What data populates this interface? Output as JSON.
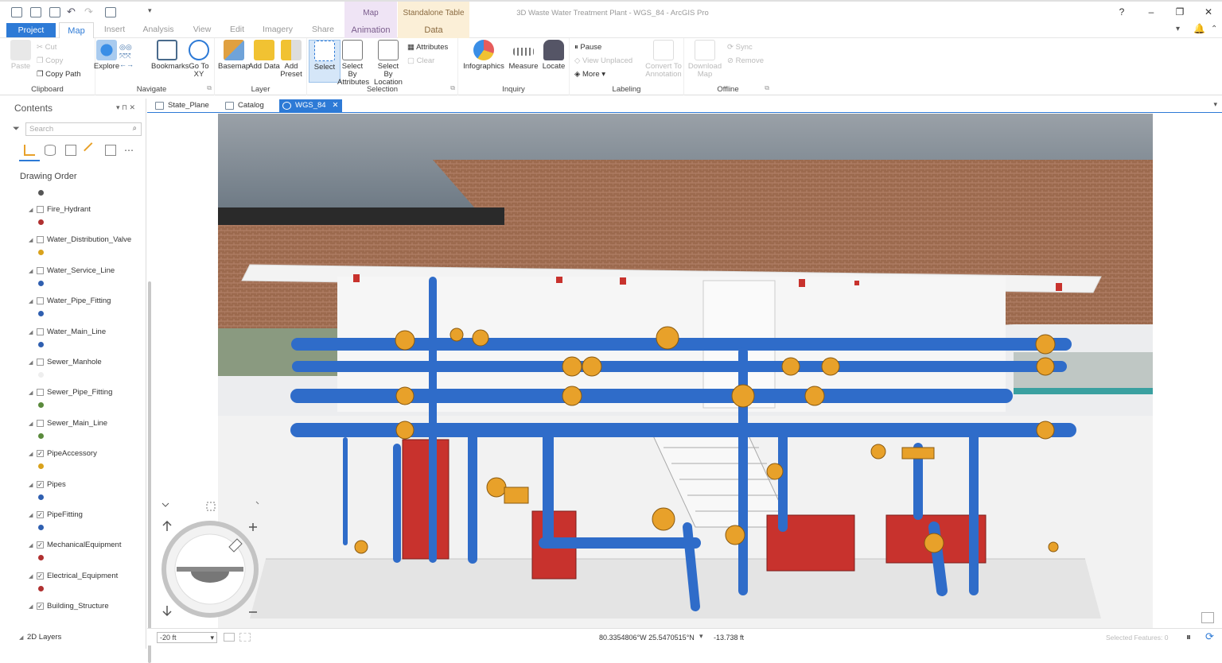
{
  "window": {
    "title": "3D Waste Water Treatment Plant - WGS_84 - ArcGIS Pro",
    "contextual_headers": {
      "map": "Map",
      "table": "Standalone Table"
    },
    "help": "?"
  },
  "ribbon_tabs": {
    "project": "Project",
    "map": "Map",
    "insert": "Insert",
    "analysis": "Analysis",
    "view": "View",
    "edit": "Edit",
    "imagery": "Imagery",
    "share": "Share",
    "animation": "Animation",
    "data": "Data"
  },
  "ribbon": {
    "clipboard": {
      "label": "Clipboard",
      "paste": "Paste",
      "cut": "Cut",
      "copy": "Copy",
      "copy_path": "Copy Path"
    },
    "navigate": {
      "label": "Navigate",
      "explore": "Explore",
      "bookmarks": "Bookmarks",
      "go_to_xy": "Go To XY"
    },
    "layer": {
      "label": "Layer",
      "basemap": "Basemap",
      "add_data": "Add Data",
      "add_preset": "Add Preset"
    },
    "selection": {
      "label": "Selection",
      "select": "Select",
      "select_by_attributes": "Select By Attributes",
      "select_by_location": "Select By Location",
      "attributes": "Attributes",
      "clear": "Clear"
    },
    "inquiry": {
      "label": "Inquiry",
      "infographics": "Infographics",
      "measure": "Measure",
      "locate": "Locate"
    },
    "labeling": {
      "label": "Labeling",
      "pause": "Pause",
      "view_unplaced": "View Unplaced",
      "more": "More",
      "convert_to_annotation": "Convert To Annotation"
    },
    "offline": {
      "label": "Offline",
      "download_map": "Download Map",
      "sync": "Sync",
      "remove": "Remove"
    }
  },
  "doc_tabs": [
    "State_Plane",
    "Catalog",
    "WGS_84"
  ],
  "contents": {
    "title": "Contents",
    "search_placeholder": "Search",
    "drawing_order": "Drawing Order",
    "layers": [
      {
        "name": "Fire_Hydrant",
        "checked": false,
        "color": "#b03030"
      },
      {
        "name": "Water_Distribution_Valve",
        "checked": false,
        "color": "#d9a21c"
      },
      {
        "name": "Water_Service_Line",
        "checked": false,
        "color": "#2f5fb0"
      },
      {
        "name": "Water_Pipe_Fitting",
        "checked": false,
        "color": "#2f5fb0"
      },
      {
        "name": "Water_Main_Line",
        "checked": false,
        "color": "#2f5fb0"
      },
      {
        "name": "Sewer_Manhole",
        "checked": false,
        "color": "#eeeeee"
      },
      {
        "name": "Sewer_Pipe_Fitting",
        "checked": false,
        "color": "#5a8a3c"
      },
      {
        "name": "Sewer_Main_Line",
        "checked": false,
        "color": "#5a8a3c"
      },
      {
        "name": "PipeAccessory",
        "checked": true,
        "color": "#d9a21c"
      },
      {
        "name": "Pipes",
        "checked": true,
        "color": "#2f5fb0"
      },
      {
        "name": "PipeFitting",
        "checked": true,
        "color": "#2f5fb0"
      },
      {
        "name": "MechanicalEquipment",
        "checked": true,
        "color": "#b03030"
      },
      {
        "name": "Electrical_Equipment",
        "checked": true,
        "color": "#b03030"
      },
      {
        "name": "Building_Structure",
        "checked": true,
        "color": ""
      }
    ],
    "group_2d": "2D Layers"
  },
  "status": {
    "scale": "-20 ft",
    "coords": "80.3354806°W 25.5470515°N",
    "elevation": "-13.738 ft",
    "selected_features": "Selected Features: 0"
  },
  "colors": {
    "accent": "#2d7ad6",
    "pipe_blue": "#2f6cc9",
    "fitting_orange": "#e8a12a",
    "equipment_red": "#c8322d"
  }
}
